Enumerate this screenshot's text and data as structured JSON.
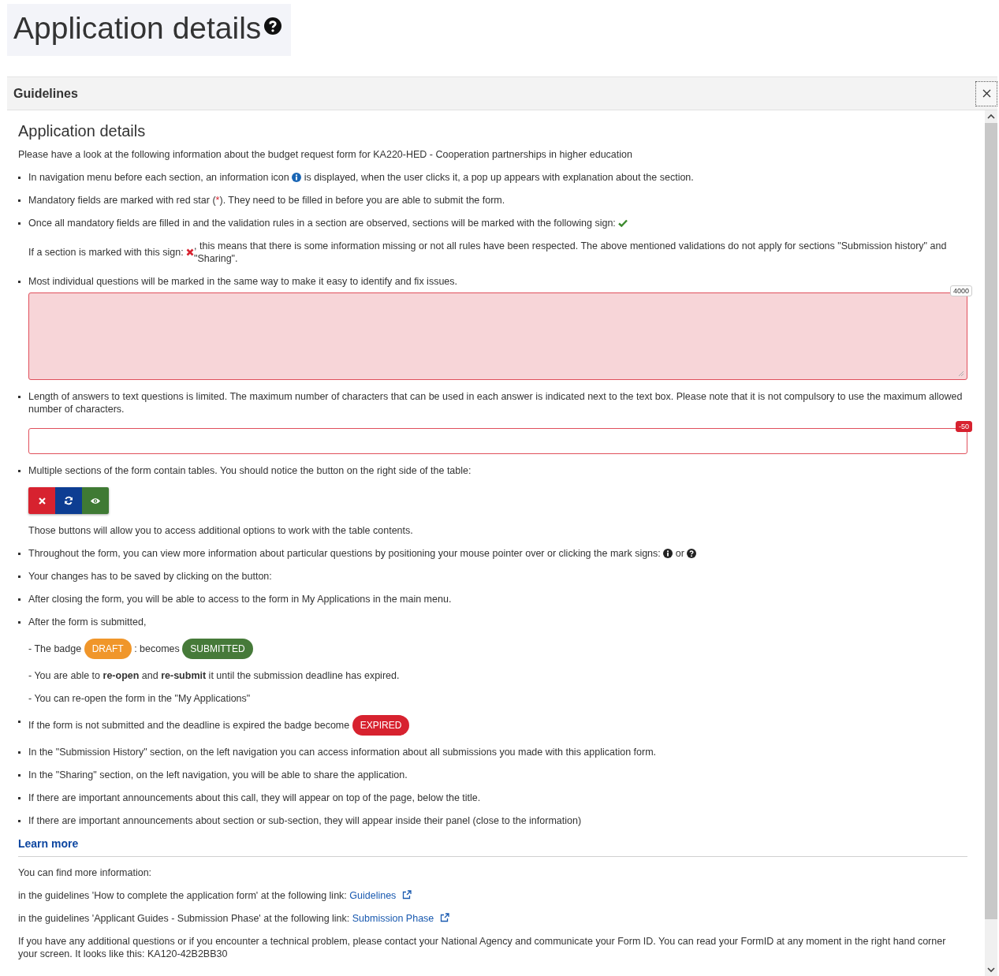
{
  "page_title": {
    "text": "Application details"
  },
  "panel": {
    "title": "Guidelines",
    "heading": "Application details",
    "intro": "Please have a look at the following information about the budget request form for KA220-HED - Cooperation partnerships in higher education"
  },
  "items": [
    {
      "segments": [
        {
          "kind": "text",
          "text": "In navigation menu before each section, an information icon "
        },
        {
          "kind": "info-icon"
        },
        {
          "kind": "text",
          "text": " is displayed, when the user clicks it, a pop up appears with explanation about the section."
        }
      ]
    },
    {
      "segments": [
        {
          "kind": "text",
          "text": "Mandatory fields are marked with red star ("
        },
        {
          "kind": "star",
          "text": "*"
        },
        {
          "kind": "text",
          "text": "). They need to be filled in before you are able to submit the form."
        }
      ]
    },
    {
      "segments": [
        {
          "kind": "text",
          "text": "Once all mandatory fields are filled in and the validation rules in a section are observed, sections will be marked with the following sign: "
        },
        {
          "kind": "check-icon"
        }
      ],
      "extras": [
        {
          "kind": "note",
          "segments": [
            {
              "kind": "text",
              "text": "If a section is marked with this sign: "
            },
            {
              "kind": "cross-icon"
            },
            {
              "kind": "text",
              "text": ", this means that there is some information missing or not all rules have been respected. The above mentioned validations do not apply for sections \"Submission history\" and \"Sharing\"."
            }
          ]
        }
      ]
    },
    {
      "segments": [
        {
          "kind": "text",
          "text": "Most individual questions will be marked in the same way to make it easy to identify and fix issues."
        }
      ],
      "extras": [
        {
          "kind": "textarea",
          "counter": "4000",
          "over_limit": false
        }
      ]
    },
    {
      "segments": [
        {
          "kind": "text",
          "text": "Length of answers to text questions is limited. The maximum number of characters that can be used in each answer is indicated next to the text box. Please note that it is not compulsory to use the maximum allowed number of characters."
        }
      ],
      "extras": [
        {
          "kind": "input",
          "counter": "-50",
          "over_limit": true
        }
      ]
    },
    {
      "segments": [
        {
          "kind": "text",
          "text": "Multiple sections of the form contain tables. You should notice the button on the right side of the table:"
        }
      ],
      "extras": [
        {
          "kind": "buttons",
          "buttons": [
            {
              "kind": "delete"
            },
            {
              "kind": "refresh"
            },
            {
              "kind": "view"
            }
          ]
        },
        {
          "kind": "note",
          "segments": [
            {
              "kind": "text",
              "text": "Those buttons will allow you to access additional options to work with the table contents."
            }
          ]
        }
      ]
    },
    {
      "segments": [
        {
          "kind": "text",
          "text": "Throughout the form, you can view more information about particular questions by positioning your mouse pointer over or clicking the mark signs: "
        },
        {
          "kind": "info-dark-icon"
        },
        {
          "kind": "text",
          "text": " or "
        },
        {
          "kind": "question-icon"
        }
      ]
    },
    {
      "segments": [
        {
          "kind": "text",
          "text": "Your changes has to be saved by clicking on the button:"
        }
      ]
    },
    {
      "segments": [
        {
          "kind": "text",
          "text": "After closing the form, you will be able to access to the form in My Applications in the main menu."
        }
      ]
    },
    {
      "segments": [
        {
          "kind": "text",
          "text": "After the form is submitted,"
        }
      ],
      "extras": [
        {
          "kind": "note",
          "segments": [
            {
              "kind": "text",
              "text": "- The badge "
            },
            {
              "kind": "badge",
              "text": "DRAFT",
              "color": "#f0962a"
            },
            {
              "kind": "text",
              "text": " : becomes "
            },
            {
              "kind": "badge",
              "text": "SUBMITTED",
              "color": "#467a39"
            }
          ]
        },
        {
          "kind": "note",
          "segments": [
            {
              "kind": "rich",
              "text": "- You are able to **re-open** and **re-submit** it until the submission deadline has expired."
            }
          ]
        },
        {
          "kind": "note",
          "segments": [
            {
              "kind": "text",
              "text": "- You can re-open the form in the \"My Applications\""
            }
          ]
        }
      ]
    },
    {
      "segments": [
        {
          "kind": "text",
          "text": "If the form is not submitted and the deadline is expired the badge become "
        },
        {
          "kind": "badge",
          "text": "EXPIRED",
          "color": "#d7222f"
        }
      ]
    },
    {
      "segments": [
        {
          "kind": "text",
          "text": "In the \"Submission History\" section, on the left navigation you can access information about all submissions you made with this application form."
        }
      ]
    },
    {
      "segments": [
        {
          "kind": "text",
          "text": "In the \"Sharing\" section, on the left navigation, you will be able to share the application."
        }
      ]
    },
    {
      "segments": [
        {
          "kind": "text",
          "text": "If there are important announcements about this call, they will appear on top of the page, below the title."
        }
      ]
    },
    {
      "segments": [
        {
          "kind": "text",
          "text": "If there are important announcements about section or sub-section, they will appear inside their panel (close to the information)"
        }
      ]
    }
  ],
  "learn_more": {
    "title": "Learn more",
    "intro": "You can find more information:",
    "links": [
      {
        "text": "in the guidelines 'How to complete the application form' at the following link: ",
        "link": "Guidelines"
      },
      {
        "text": "in the guidelines 'Applicant Guides - Submission Phase' at the following link: ",
        "link": "Submission Phase"
      }
    ],
    "footer": "If you have any additional questions or if you encounter a technical problem, please contact your National Agency and communicate your Form ID. You can read your FormID at any moment in the right hand corner your screen. It looks like this: KA120-42B2BB30"
  }
}
